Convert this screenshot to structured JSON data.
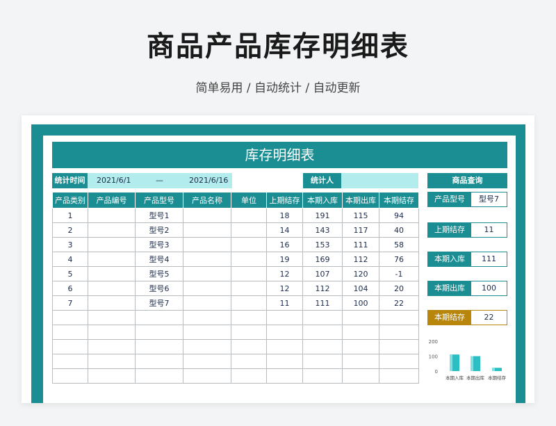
{
  "page": {
    "title": "商品产品库存明细表",
    "subtitle": "简单易用 / 自动统计 / 自动更新"
  },
  "sheet": {
    "banner": "库存明细表",
    "info": {
      "time_label": "统计时间",
      "start_date": "2021/6/1",
      "dash": "—",
      "end_date": "2021/6/16",
      "person_label": "统计人",
      "person_value": ""
    },
    "columns": [
      "产品类别",
      "产品编号",
      "产品型号",
      "产品名称",
      "单位",
      "上期结存",
      "本期入库",
      "本期出库",
      "本期结存"
    ],
    "rows": [
      [
        "1",
        "",
        "型号1",
        "",
        "",
        "18",
        "191",
        "115",
        "94"
      ],
      [
        "2",
        "",
        "型号2",
        "",
        "",
        "14",
        "143",
        "117",
        "40"
      ],
      [
        "3",
        "",
        "型号3",
        "",
        "",
        "16",
        "153",
        "111",
        "58"
      ],
      [
        "4",
        "",
        "型号4",
        "",
        "",
        "19",
        "169",
        "112",
        "76"
      ],
      [
        "5",
        "",
        "型号5",
        "",
        "",
        "12",
        "107",
        "120",
        "-1"
      ],
      [
        "6",
        "",
        "型号6",
        "",
        "",
        "12",
        "112",
        "104",
        "20"
      ],
      [
        "7",
        "",
        "型号7",
        "",
        "",
        "11",
        "111",
        "100",
        "22"
      ],
      [
        "",
        "",
        "",
        "",
        "",
        "",
        "",
        "",
        ""
      ],
      [
        "",
        "",
        "",
        "",
        "",
        "",
        "",
        "",
        ""
      ],
      [
        "",
        "",
        "",
        "",
        "",
        "",
        "",
        "",
        ""
      ],
      [
        "",
        "",
        "",
        "",
        "",
        "",
        "",
        "",
        ""
      ],
      [
        "",
        "",
        "",
        "",
        "",
        "",
        "",
        "",
        ""
      ]
    ]
  },
  "query": {
    "title": "商品查询",
    "model_label": "产品型号",
    "model_value": "型号7",
    "prev_label": "上期结存",
    "prev_value": "11",
    "in_label": "本期入库",
    "in_value": "111",
    "out_label": "本期出库",
    "out_value": "100",
    "end_label": "本期结存",
    "end_value": "22"
  },
  "chart_data": {
    "type": "bar",
    "categories": [
      "本期入库",
      "本期出库",
      "本期结存"
    ],
    "values": [
      111,
      100,
      22
    ],
    "yticks": [
      "200",
      "100",
      "0"
    ],
    "ylim": [
      0,
      200
    ],
    "grid": false,
    "color": "#2bbfc4"
  },
  "colors": {
    "accent": "#1b8e93",
    "light": "#b3ecec",
    "gold": "#b8860b"
  }
}
